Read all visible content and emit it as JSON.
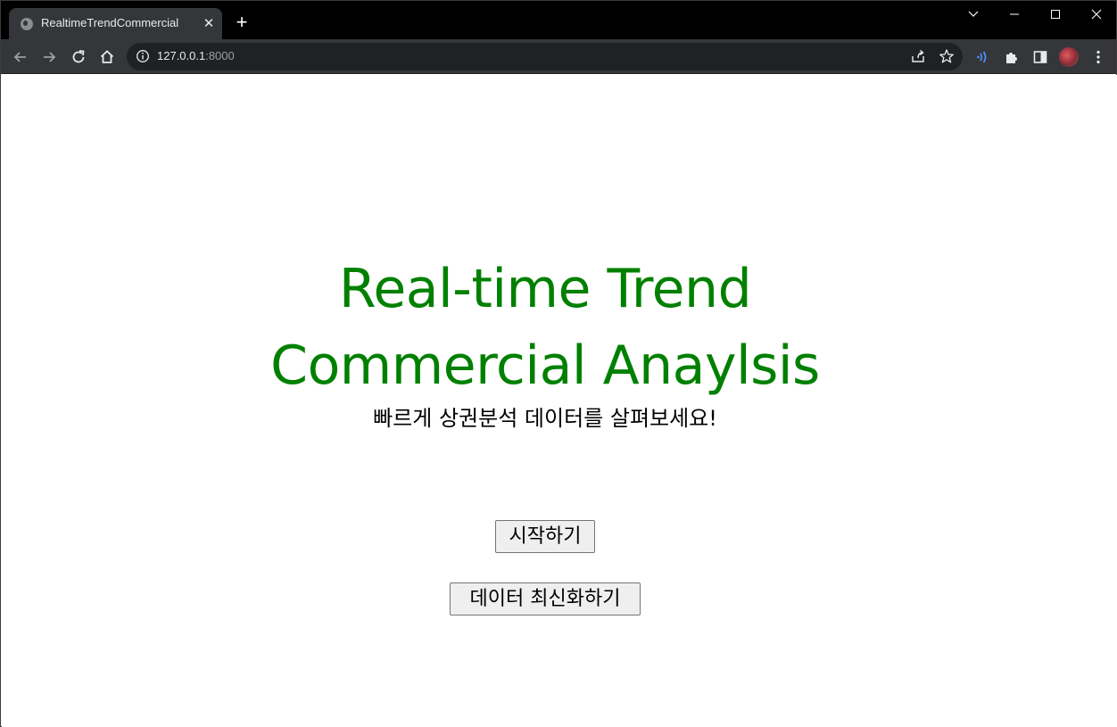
{
  "browser": {
    "tab": {
      "title": "RealtimeTrendCommercial",
      "favicon": "globe-icon"
    },
    "address_bar": {
      "host": "127.0.0.1",
      "port": ":8000"
    },
    "colors": {
      "tabstrip_bg": "#000000",
      "toolbar_bg": "#35363a",
      "omnibox_bg": "#202124"
    }
  },
  "page": {
    "title_line1": "Real-time Trend",
    "title_line2": "Commercial Anaylsis",
    "subtitle": "빠르게 상권분석 데이터를 살펴보세요!",
    "buttons": {
      "start_label": "시작하기",
      "refresh_label": "데이터 최신화하기"
    },
    "colors": {
      "title": "#008000",
      "background": "#ffffff"
    }
  }
}
